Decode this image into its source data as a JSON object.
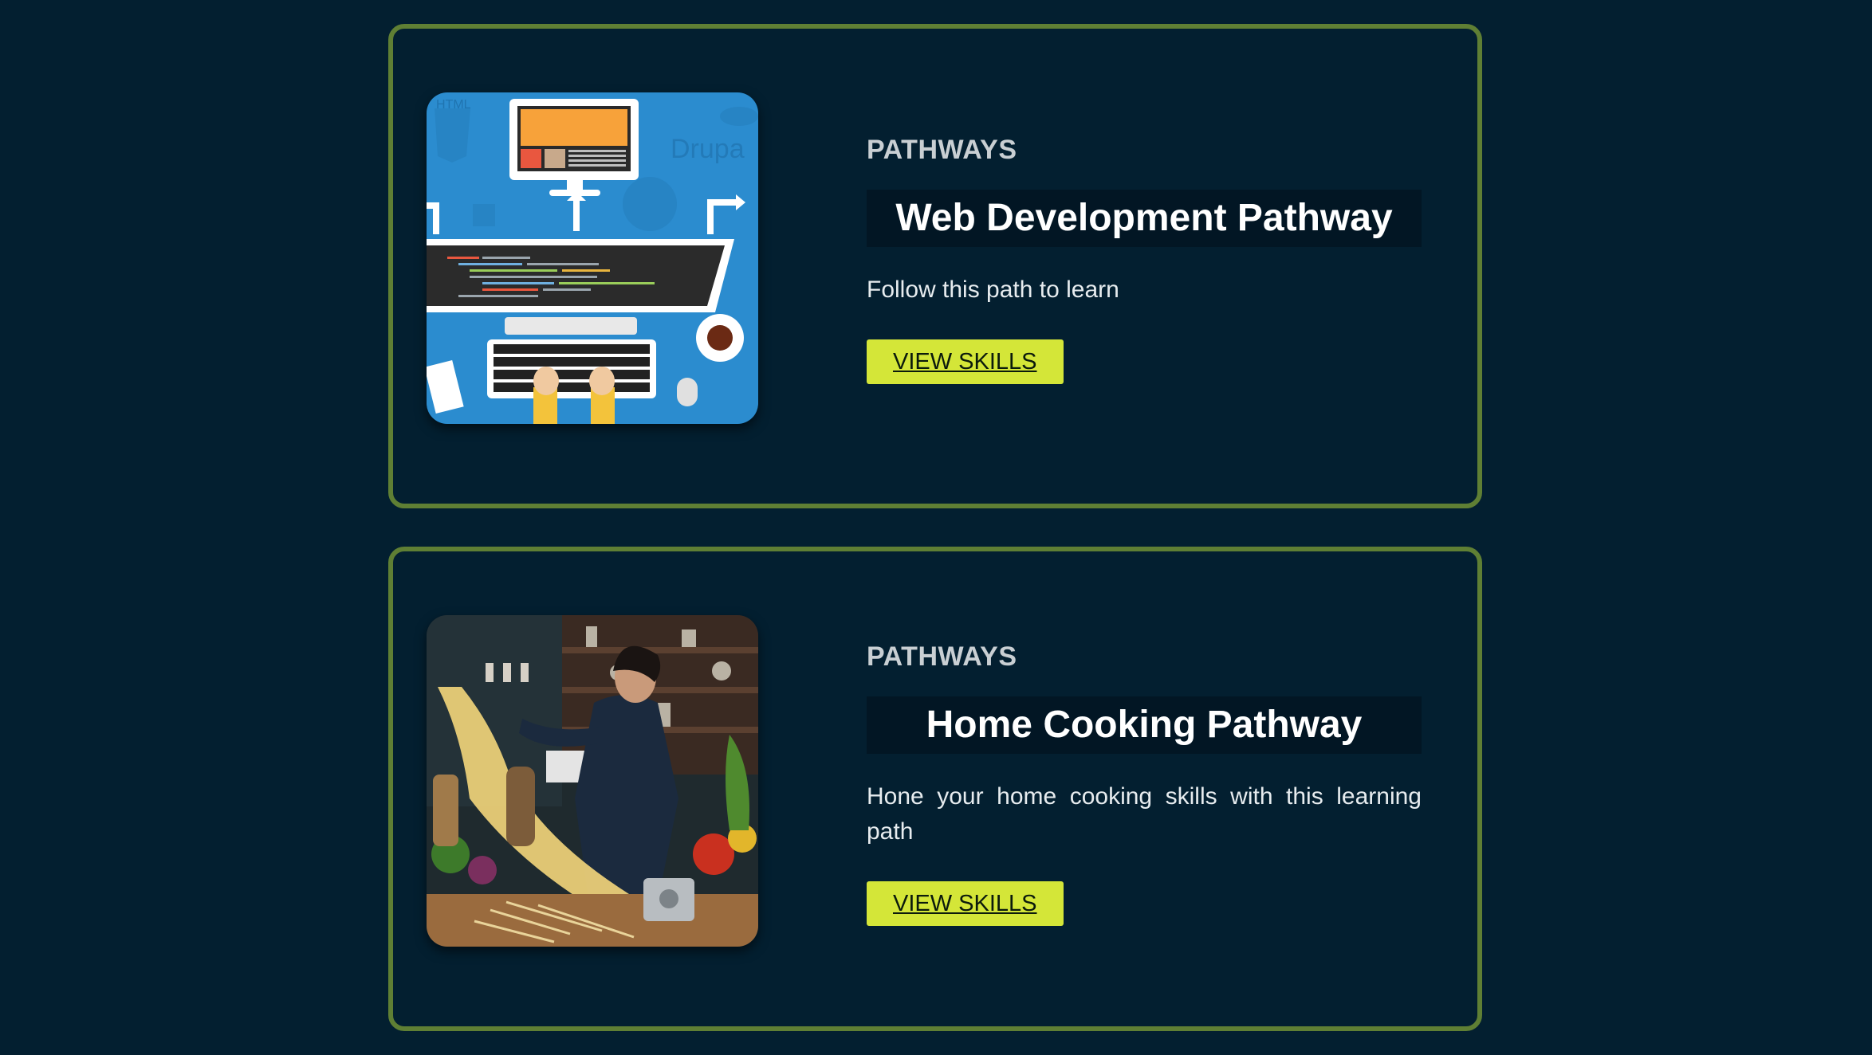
{
  "colors": {
    "background": "#031f30",
    "card_border": "#5f7f34",
    "title_box": "#021624",
    "button_bg": "#d4e638"
  },
  "pathways": [
    {
      "eyebrow": "PATHWAYS",
      "title": "Web Development Pathway",
      "description": "Follow this path to learn",
      "button_label": "VIEW SKILLS",
      "image_icon": "web-development-illustration"
    },
    {
      "eyebrow": "PATHWAYS",
      "title": "Home Cooking Pathway",
      "description": "Hone your home cooking skills with this learning path",
      "button_label": "VIEW SKILLS",
      "image_icon": "chef-cooking-photo"
    }
  ]
}
